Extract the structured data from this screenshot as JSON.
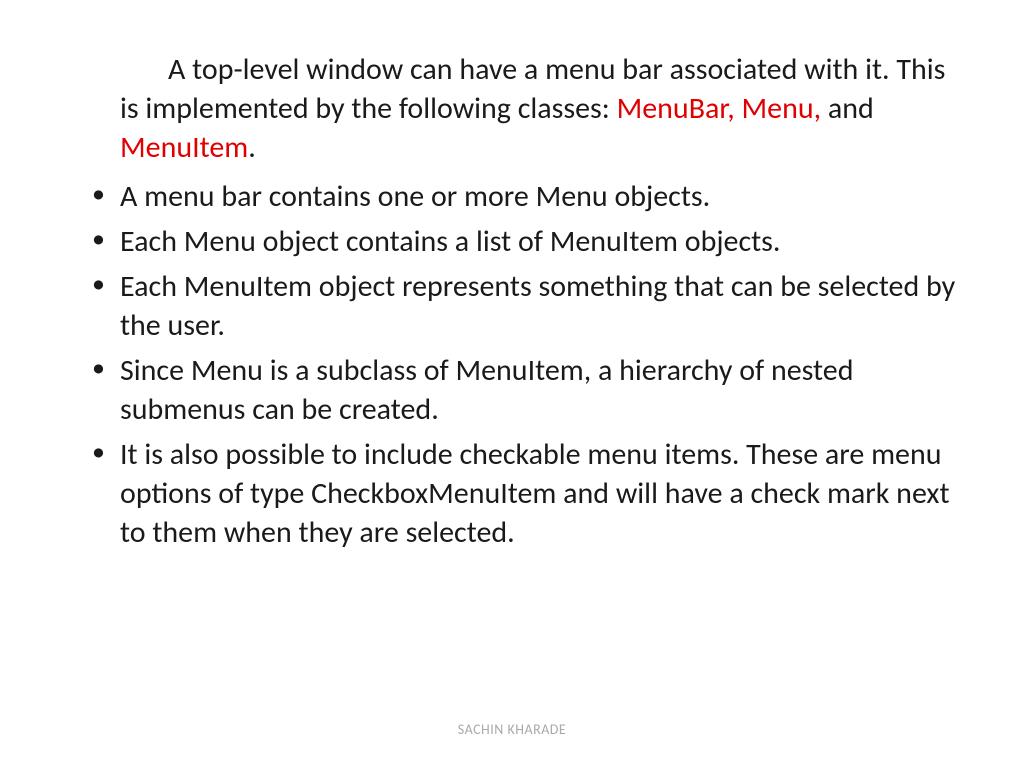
{
  "intro": {
    "part1": "A top-level window can have a menu bar associated with it. This is implemented by the following classes: ",
    "highlight1": "MenuBar, Menu,",
    "part2": " and ",
    "highlight2": "MenuItem",
    "part3": "."
  },
  "bullets": [
    "A menu bar contains one or more Menu objects.",
    "Each Menu object contains a list of MenuItem objects.",
    "Each MenuItem object represents something that can be selected by the user.",
    "Since Menu is a subclass of MenuItem, a hierarchy of nested submenus can be created.",
    "It is also possible to include checkable menu items. These are menu options of type CheckboxMenuItem and will have a check mark next to them when they are selected."
  ],
  "footer": "SACHIN KHARADE"
}
